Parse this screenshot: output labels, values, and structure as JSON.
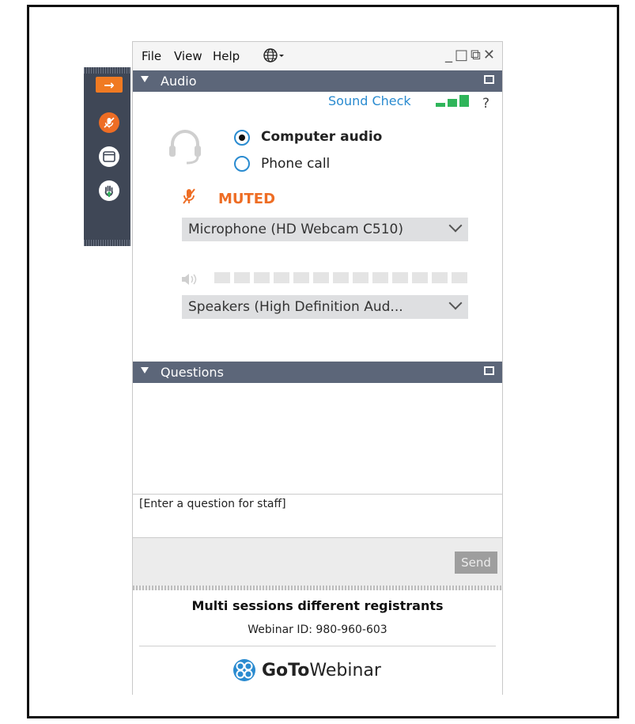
{
  "menu": {
    "file": "File",
    "view": "View",
    "help": "Help",
    "globe_icon": "globe-icon"
  },
  "window_controls": {
    "minimize": "_",
    "maximize": "□",
    "restore": "⧉",
    "close": "✕"
  },
  "audio": {
    "section_label": "Audio",
    "sound_check": "Sound Check",
    "help": "?",
    "computer_audio": "Computer audio",
    "phone_call": "Phone call",
    "selected_mode": "Computer audio",
    "muted_label": "MUTED",
    "microphone": "Microphone (HD Webcam C510)",
    "speakers": "Speakers (High Definition Aud...",
    "signal_color": "#2fb55a",
    "muted_color": "#ee6d24"
  },
  "questions": {
    "section_label": "Questions",
    "input_placeholder": "[Enter a question for staff]",
    "send_label": "Send"
  },
  "footer": {
    "title": "Multi sessions different registrants",
    "webinar_id": "Webinar ID: 980-960-603",
    "brand_bold": "GoTo",
    "brand_light": "Webinar"
  },
  "side_toolbar": {
    "items": [
      "arrow-right-icon",
      "microphone-muted-icon",
      "window-icon",
      "raise-hand-icon"
    ]
  }
}
